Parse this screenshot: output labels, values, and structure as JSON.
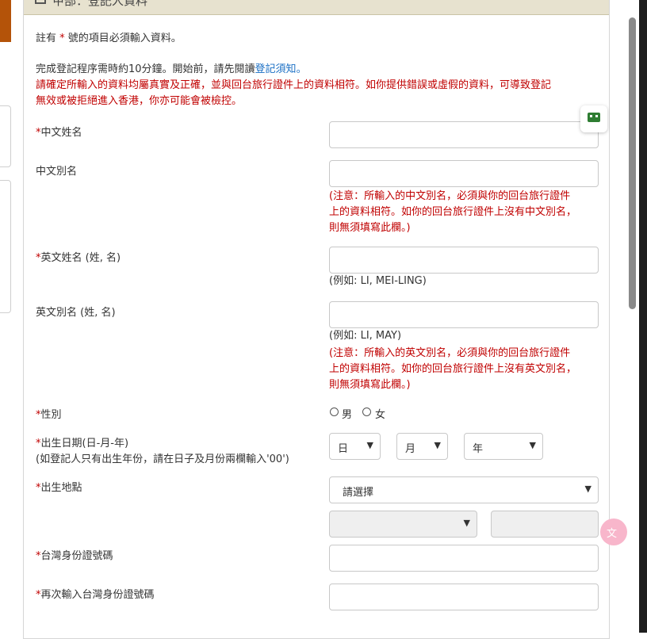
{
  "panel": {
    "title": "甲部：登記人資料"
  },
  "intro": {
    "required_note_prefix": "註有",
    "required_star": "*",
    "required_note_suffix": "號的項目必須輸入資料。",
    "time_note": "完成登記程序需時約10分鐘。開始前，請先閱讀",
    "time_note_link": "登記須知",
    "time_note_end": "。",
    "warning_line1": "請確定所輸入的資料均屬真實及正確，並與回台旅行證件上的資料相符。如你提供錯誤或虛假的資料，可導致登記",
    "warning_line2": "無效或被拒絕進入香港，你亦可能會被檢控。"
  },
  "fields": {
    "chinese_name": {
      "star": "*",
      "label": "中文姓名",
      "value": ""
    },
    "chinese_alias": {
      "label": "中文別名",
      "value": "",
      "note_line1": "(注意：所輸入的中文別名，必須與你的回台旅行證件",
      "note_line2": "上的資料相符。如你的回台旅行證件上沒有中文別名，",
      "note_line3": "則無須填寫此欄。)"
    },
    "english_name": {
      "star": "*",
      "label": "英文姓名 (姓, 名)",
      "value": "",
      "example": "(例如: LI, MEI-LING)"
    },
    "english_alias": {
      "label": "英文別名 (姓, 名)",
      "value": "",
      "example": "(例如: LI, MAY)",
      "note_line1": "(注意：所輸入的英文別名，必須與你的回台旅行證件",
      "note_line2": "上的資料相符。如你的回台旅行證件上沒有英文別名，",
      "note_line3": "則無須填寫此欄。)"
    },
    "gender": {
      "star": "*",
      "label": "性別",
      "male": "男",
      "female": "女"
    },
    "dob": {
      "star": "*",
      "label": "出生日期(日-月-年)",
      "hint": "(如登記人只有出生年份，請在日子及月份兩欄輸入'00')",
      "day": "日",
      "month": "月",
      "year": "年"
    },
    "birth_place": {
      "star": "*",
      "label": "出生地點",
      "selected": "請選擇"
    },
    "taiwan_id": {
      "star": "*",
      "label": "台灣身份證號碼",
      "value": ""
    },
    "taiwan_id_confirm": {
      "star": "*",
      "label": "再次輸入台灣身份證號碼",
      "value": ""
    }
  },
  "icons": {
    "floating_tool": "robot-icon",
    "translate": "translate-icon"
  },
  "colors": {
    "warning": "#c00000",
    "link": "#1a6fc4",
    "header": "#e7e2cf"
  }
}
